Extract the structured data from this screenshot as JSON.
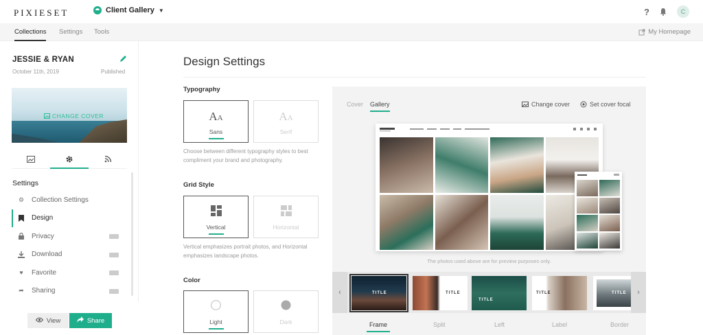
{
  "brand": {
    "name": "PIXIESET",
    "accent": "#1fae8c"
  },
  "app_switcher": {
    "label": "Client Gallery"
  },
  "header": {
    "help": "?",
    "avatar_initial": "C"
  },
  "subnav": {
    "tabs": [
      {
        "label": "Collections",
        "active": true
      },
      {
        "label": "Settings",
        "active": false
      },
      {
        "label": "Tools",
        "active": false
      }
    ],
    "homepage_link": "My Homepage"
  },
  "collection": {
    "title": "JESSIE & RYAN",
    "date": "October 11th, 2019",
    "status": "Published",
    "cover_label": "CHANGE COVER"
  },
  "sidebar": {
    "heading": "Settings",
    "items": [
      {
        "label": "Collection Settings",
        "icon": "gear-icon"
      },
      {
        "label": "Design",
        "icon": "bookmark-icon",
        "active": true
      },
      {
        "label": "Privacy",
        "icon": "lock-icon"
      },
      {
        "label": "Download",
        "icon": "download-icon"
      },
      {
        "label": "Favorite",
        "icon": "heart-icon"
      },
      {
        "label": "Sharing",
        "icon": "share-arrow-icon"
      }
    ],
    "view_label": "View",
    "share_label": "Share"
  },
  "main": {
    "title": "Design Settings",
    "typography": {
      "label": "Typography",
      "options": [
        {
          "label": "Sans",
          "selected": true
        },
        {
          "label": "Serif",
          "selected": false
        }
      ],
      "description": "Choose between different typography styles to best compliment your brand and photography."
    },
    "grid_style": {
      "label": "Grid Style",
      "options": [
        {
          "label": "Vertical",
          "selected": true
        },
        {
          "label": "Horizontal",
          "selected": false
        }
      ],
      "description": "Vertical emphasizes portrait photos, and Horizontal emphasizes landscape photos."
    },
    "color": {
      "label": "Color",
      "options": [
        {
          "label": "Light",
          "selected": true
        },
        {
          "label": "Dark",
          "selected": false
        }
      ]
    }
  },
  "preview": {
    "tabs": [
      {
        "label": "Cover",
        "active": false
      },
      {
        "label": "Gallery",
        "active": true
      }
    ],
    "change_cover": "Change cover",
    "set_cover_focal": "Set cover focal",
    "note": "The photos used above are for preview purposes only.",
    "thumb_title": "TITLE",
    "layouts": [
      {
        "label": "Frame",
        "active": true
      },
      {
        "label": "Split",
        "active": false
      },
      {
        "label": "Left",
        "active": false
      },
      {
        "label": "Label",
        "active": false
      },
      {
        "label": "Border",
        "active": false
      }
    ]
  }
}
